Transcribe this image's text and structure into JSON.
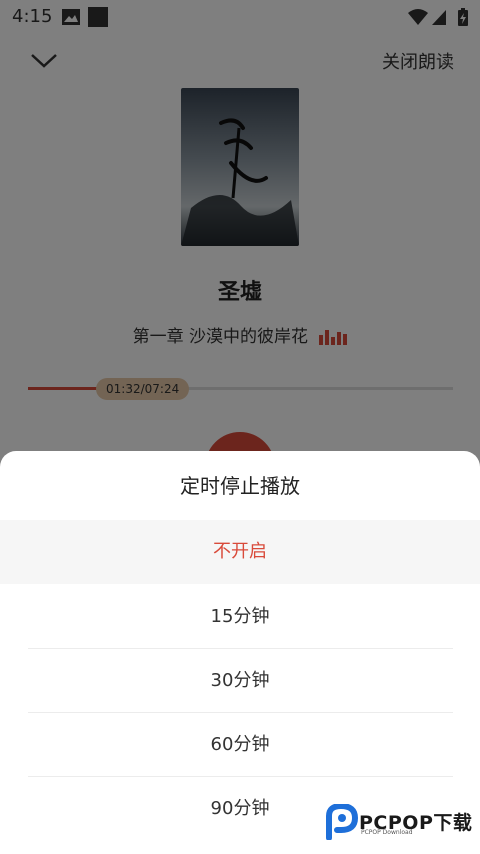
{
  "status_bar": {
    "time": "4:15"
  },
  "player": {
    "close_reading_label": "关闭朗读",
    "book_title": "圣墟",
    "chapter_title": "第一章 沙漠中的彼岸花",
    "progress_time": "01:32/07:24",
    "progress_fraction": 0.207
  },
  "timer_sheet": {
    "title": "定时停止播放",
    "options": [
      {
        "label": "不开启",
        "selected": true
      },
      {
        "label": "15分钟",
        "selected": false
      },
      {
        "label": "30分钟",
        "selected": false
      },
      {
        "label": "60分钟",
        "selected": false
      },
      {
        "label": "90分钟",
        "selected": false
      }
    ]
  },
  "watermark": {
    "text": "PCPOP下载",
    "sub": "PCPOP Download"
  },
  "colors": {
    "accent": "#d94a3a",
    "progress_badge": "#e6c9a8",
    "overlay": "rgba(0,0,0,0.5)"
  }
}
